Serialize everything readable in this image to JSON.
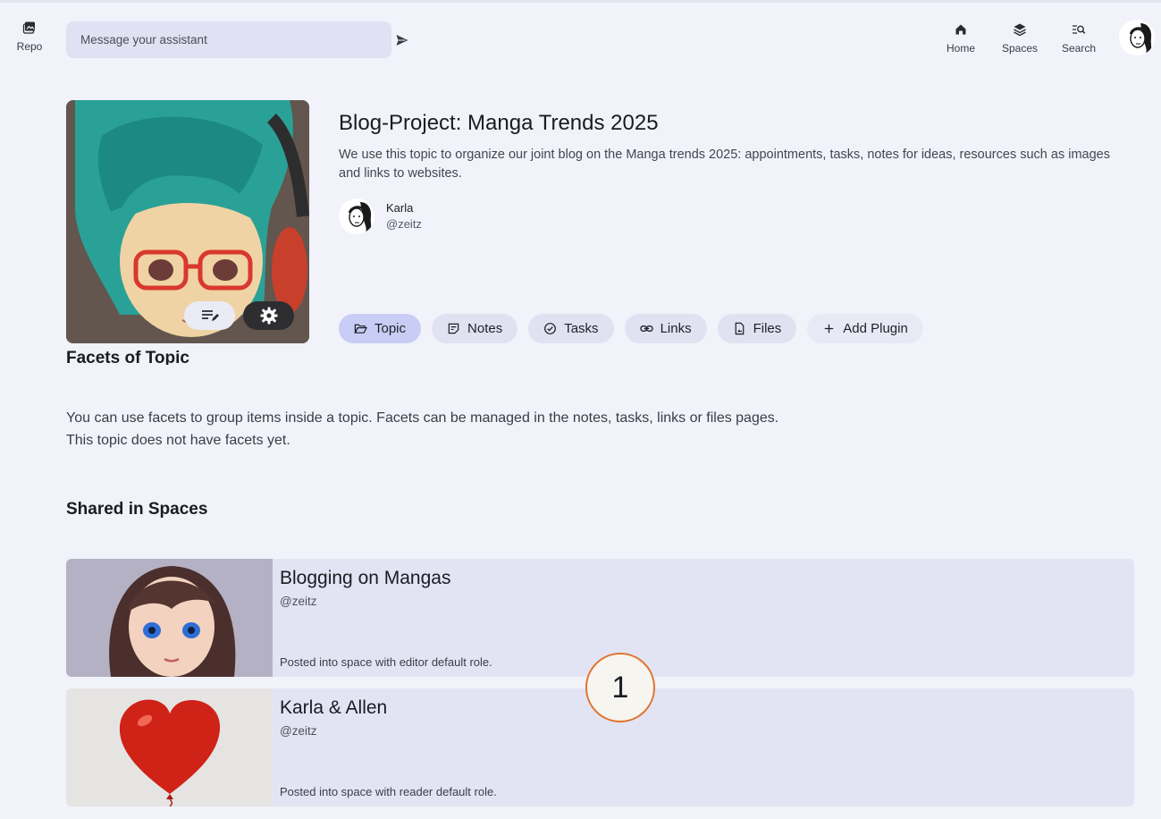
{
  "nav": {
    "repo_label": "Repo",
    "message_placeholder": "Message your assistant",
    "home_label": "Home",
    "spaces_label": "Spaces",
    "search_label": "Search"
  },
  "topic": {
    "title": "Blog-Project: Manga Trends 2025",
    "description": "We use this topic to organize our joint blog on the Manga trends 2025: appointments, tasks, notes for ideas, resources such as images and links to websites.",
    "owner_name": "Karla",
    "owner_handle": "@zeitz"
  },
  "tabs": [
    {
      "label": "Topic",
      "icon": "folder-open-icon",
      "active": true
    },
    {
      "label": "Notes",
      "icon": "note-icon"
    },
    {
      "label": "Tasks",
      "icon": "check-circle-icon"
    },
    {
      "label": "Links",
      "icon": "link-icon"
    },
    {
      "label": "Files",
      "icon": "file-icon"
    },
    {
      "label": "Add Plugin",
      "icon": "plus-icon"
    }
  ],
  "facets": {
    "title": "Facets of Topic",
    "line1": "You can use facets to group items inside a topic. Facets can be managed in the notes, tasks, links or files pages.",
    "line2": "This topic does not have facets yet."
  },
  "shared": {
    "title": "Shared in Spaces",
    "spaces": [
      {
        "name": "Blogging on Mangas",
        "handle": "@zeitz",
        "note": "Posted into space with editor default role."
      },
      {
        "name": "Karla & Allen",
        "handle": "@zeitz",
        "note": "Posted into space with reader default role."
      }
    ]
  },
  "marker_label": "1",
  "colors": {
    "background": "#f1f2fa",
    "active_tab": "#c9cdf5",
    "tab": "#e1e2f1",
    "card": "#e3e4f3",
    "marker_border": "#e0742f"
  }
}
